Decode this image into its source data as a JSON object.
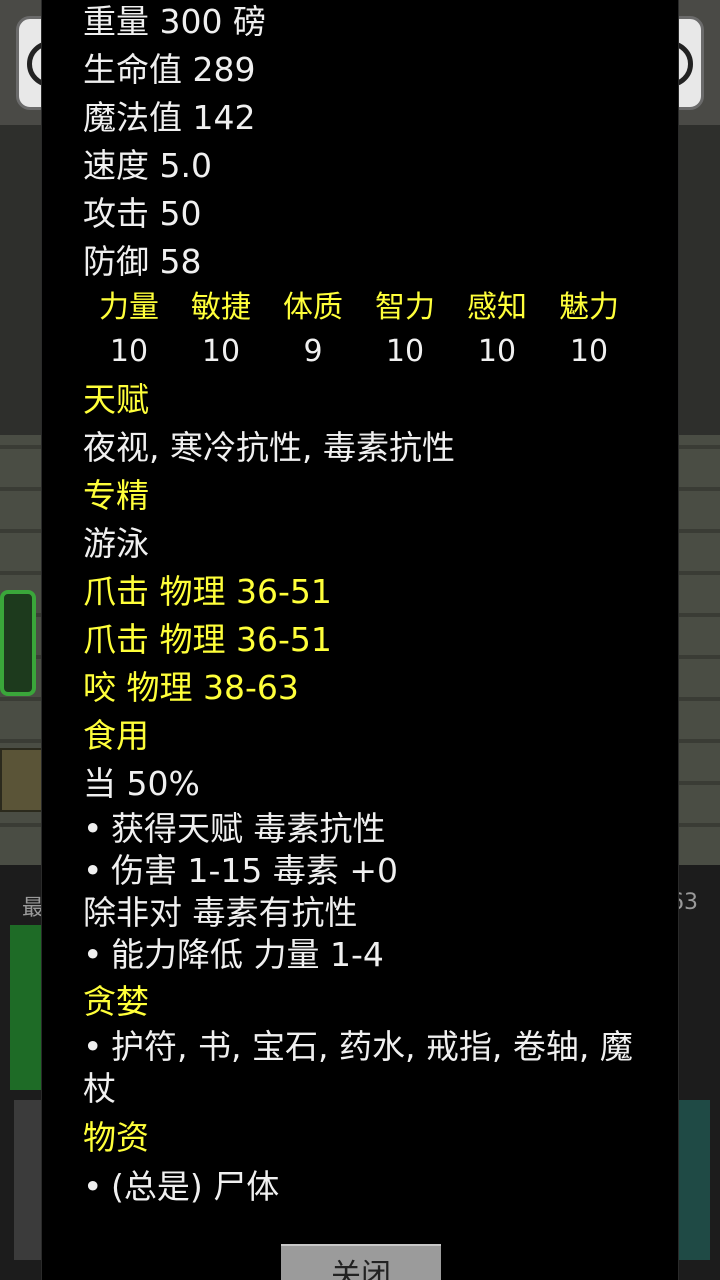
{
  "background": {
    "left_snippet": "最",
    "right_snippet": "63"
  },
  "dialog": {
    "weight": "重量 300 磅",
    "hp": "生命值 289",
    "mp": "魔法值 142",
    "speed": "速度 5.0",
    "attack": "攻击 50",
    "defense": "防御 58",
    "stats": [
      {
        "name": "力量",
        "value": "10"
      },
      {
        "name": "敏捷",
        "value": "10"
      },
      {
        "name": "体质",
        "value": "9"
      },
      {
        "name": "智力",
        "value": "10"
      },
      {
        "name": "感知",
        "value": "10"
      },
      {
        "name": "魅力",
        "value": "10"
      }
    ],
    "talent_header": "天赋",
    "talents": "夜视, 寒冷抗性, 毒素抗性",
    "spec_header": "专精",
    "spec": "游泳",
    "attacks": [
      "爪击 物理 36-51",
      "爪击 物理 36-51",
      "咬 物理 38-63"
    ],
    "eat_header": "食用",
    "eat_chance": "当 50%",
    "eat_effect1": "获得天赋 毒素抗性",
    "eat_effect2": "伤害 1-15 毒素 +0",
    "eat_unless": "除非对 毒素有抗性",
    "eat_effect3": "能力降低 力量 1-4",
    "greed_header": "贪婪",
    "greed_items": "护符, 书, 宝石, 药水, 戒指, 卷轴, 魔杖",
    "loot_header": "物资",
    "loot_items": "(总是) 尸体",
    "bullet": "•",
    "close_label": "关闭"
  }
}
